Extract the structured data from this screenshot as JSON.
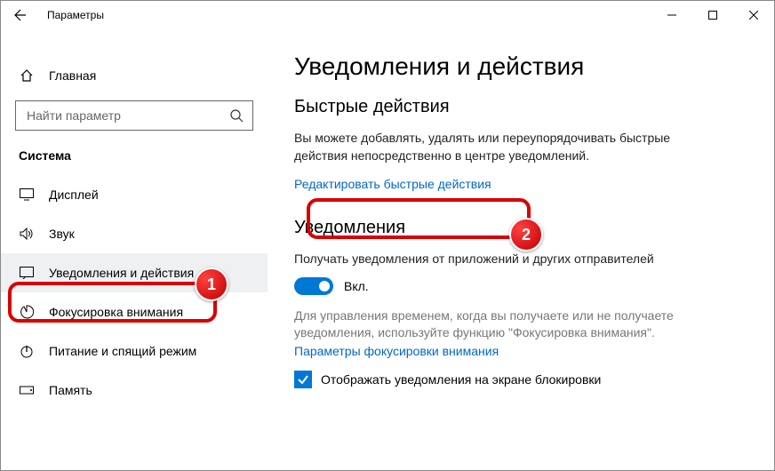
{
  "window": {
    "title": "Параметры"
  },
  "sidebar": {
    "home": "Главная",
    "search_placeholder": "Найти параметр",
    "section": "Система",
    "items": [
      {
        "label": "Дисплей"
      },
      {
        "label": "Звук"
      },
      {
        "label": "Уведомления и действия"
      },
      {
        "label": "Фокусировка внимания"
      },
      {
        "label": "Питание и спящий режим"
      },
      {
        "label": "Память"
      }
    ]
  },
  "main": {
    "title": "Уведомления и действия",
    "quick": {
      "heading": "Быстрые действия",
      "desc": "Вы можете добавлять, удалять или переупорядочивать быстрые действия непосредственно в центре уведомлений.",
      "link": "Редактировать быстрые действия"
    },
    "notif": {
      "heading": "Уведомления",
      "get_label": "Получать уведомления от приложений и других отправителей",
      "toggle_state": "Вкл.",
      "focus_desc": "Для управления временем, когда вы получаете или не получаете уведомления, используйте функцию \"Фокусировка внимания\".",
      "focus_link": "Параметры фокусировки внимания",
      "lock_screen": "Отображать уведомления на экране блокировки"
    }
  },
  "annotations": {
    "badge1": "1",
    "badge2": "2"
  }
}
